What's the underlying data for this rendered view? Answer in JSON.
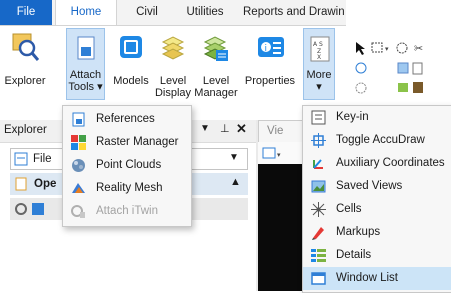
{
  "ribbon_tabs": [
    "File",
    "Home",
    "Civil",
    "Utilities",
    "Reports and Drawin"
  ],
  "ribbon_buttons": {
    "explorer": "Explorer",
    "attach_tools_1": "Attach",
    "attach_tools_2": "Tools ▾",
    "models": "Models",
    "level_display_1": "Level",
    "level_display_2": "Display",
    "level_manager_1": "Level",
    "level_manager_2": "Manager",
    "properties": "Properties",
    "more_1": "More",
    "more_2": "▾"
  },
  "explorer_panel": {
    "title": "Explorer",
    "file_label": "File",
    "open_label": "Ope",
    "tail_y": "y",
    "view_tab": "Vie"
  },
  "attach_menu": [
    {
      "label": "References",
      "icon": "references-icon",
      "enabled": true
    },
    {
      "label": "Raster Manager",
      "icon": "raster-manager-icon",
      "enabled": true
    },
    {
      "label": "Point Clouds",
      "icon": "point-clouds-icon",
      "enabled": true
    },
    {
      "label": "Reality Mesh",
      "icon": "reality-mesh-icon",
      "enabled": true
    },
    {
      "label": "Attach iTwin",
      "icon": "attach-itwin-icon",
      "enabled": false
    }
  ],
  "more_menu": [
    {
      "label": "Key-in",
      "icon": "key-in-icon"
    },
    {
      "label": "Toggle AccuDraw",
      "icon": "accudraw-icon"
    },
    {
      "label": "Auxiliary Coordinates",
      "icon": "aux-coordinates-icon"
    },
    {
      "label": "Saved Views",
      "icon": "saved-views-icon"
    },
    {
      "label": "Cells",
      "icon": "cells-icon"
    },
    {
      "label": "Markups",
      "icon": "markups-icon"
    },
    {
      "label": "Details",
      "icon": "details-icon"
    },
    {
      "label": "Window List",
      "icon": "window-list-icon",
      "highlighted": true
    }
  ],
  "colors": {
    "accent": "#1768c8",
    "highlight": "#cce4f7",
    "selected": "#cfe3f7"
  }
}
